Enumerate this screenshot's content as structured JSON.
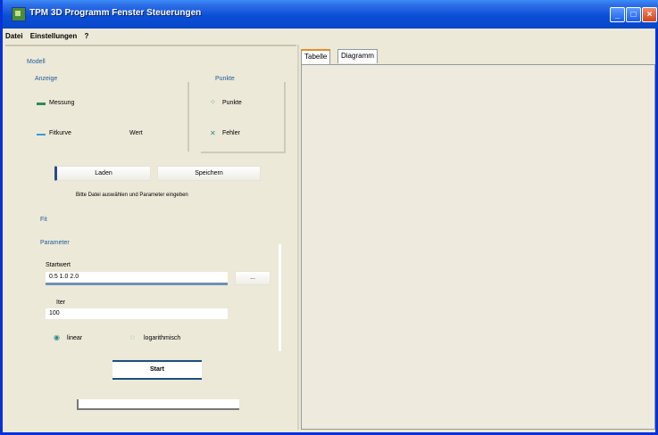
{
  "window": {
    "title": "TPM 3D Programm Fenster Steuerungen",
    "min_label": "_",
    "max_label": "□",
    "close_label": "×"
  },
  "menu": {
    "items": [
      "Datei",
      "Einstellungen",
      "?"
    ]
  },
  "left": {
    "section_title": "Modell",
    "group_left_title": "Anzeige",
    "group_right_title": "Punkte",
    "legend1_label": "Messung",
    "legend2_label": "Fitkurve",
    "legend2_value": "Wert",
    "legend3_label": "Punkte",
    "legend4_label": "Fehler",
    "button1_label": "Laden",
    "button2_label": "Speichern",
    "hint_text": "Bitte Datei auswählen und Parameter eingeben",
    "section2_title": "Fit",
    "section3_title": "Parameter",
    "param1_label": "Startwert",
    "param1_value": "0.5  1.0  2.0",
    "param1_button": "...",
    "param2_label": "Iter",
    "param2_value": "100",
    "radio1_label": "linear",
    "radio2_label": "logarithmisch",
    "go_button": "Start"
  },
  "tabs": [
    "Tabelle",
    "Diagramm"
  ],
  "colors": {
    "accent": "#2b6fb3",
    "titlebar": "#0a4fd6",
    "tab_highlight": "#e68b2c"
  }
}
